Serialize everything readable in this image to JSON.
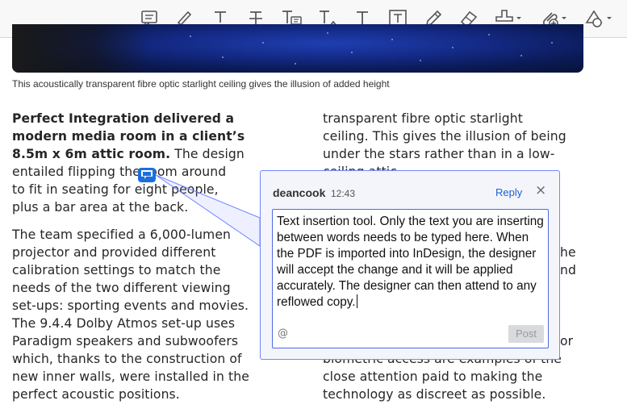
{
  "toolbar": {
    "tools": [
      {
        "name": "comment-tool",
        "icon": "comment-icon"
      },
      {
        "name": "highlight-tool",
        "icon": "highlighter-icon"
      },
      {
        "name": "underline-tool",
        "icon": "underline-text-icon"
      },
      {
        "name": "strikethrough-tool",
        "icon": "strikethrough-text-icon"
      },
      {
        "name": "replace-text-tool",
        "icon": "replace-text-icon"
      },
      {
        "name": "insert-text-tool",
        "icon": "insert-text-icon"
      },
      {
        "name": "add-text-tool",
        "icon": "text-icon"
      },
      {
        "name": "text-box-tool",
        "icon": "text-box-icon"
      },
      {
        "name": "draw-tool",
        "icon": "pencil-icon"
      },
      {
        "name": "eraser-tool",
        "icon": "eraser-icon"
      },
      {
        "name": "stamp-tool",
        "icon": "stamp-icon"
      },
      {
        "name": "attach-file-tool",
        "icon": "attachment-icon"
      },
      {
        "name": "shapes-tool",
        "icon": "shapes-icon"
      }
    ]
  },
  "caption": "This acoustically transparent fibre optic starlight ceiling gives the illusion of added height",
  "article": {
    "col1": {
      "p1_bold": [
        "Perfect Integration delivered a",
        "modern media room in a client’s",
        "8.5m x 6m attic room."
      ],
      "p1_rest_inline": " The design",
      "p1_lines": [
        "entailed flipping the room around",
        "to fit in seating for eight people,",
        "plus a bar area at the back."
      ],
      "p2_lines": [
        "The team specified a 6,000-lumen",
        "projector and provided different",
        "calibration settings to match the",
        "needs of the two different viewing",
        "set-ups: sporting events and movies.",
        "The 9.4.4 Dolby Atmos set-up uses",
        "Paradigm speakers and subwoofers",
        "which, thanks to the construction of",
        "new inner walls, were installed in the",
        "perfect acoustic positions."
      ]
    },
    "col2": {
      "top_lines": [
        "transparent fibre optic starlight",
        "ceiling. This gives the illusion of being",
        "under the stars rather than in a low-",
        "ceiling attic."
      ],
      "side_fragments": [
        "he",
        "nd"
      ],
      "bottom_lines": [
        "biometric access are examples of the",
        "close attention paid to making the",
        "technology as discreet as possible."
      ],
      "bottom_partial": "or"
    }
  },
  "comment": {
    "author": "deancook",
    "time": "12:43",
    "reply_label": "Reply",
    "close_label": "×",
    "body": "Text insertion tool. Only the text you are inserting between words needs to be typed here. When the PDF is imported into InDesign, the designer will accept the change and it will be applied accurately. The designer can then attend to any reflowed copy.",
    "mention_label": "@",
    "post_label": "Post"
  },
  "colors": {
    "accent": "#1a62d6",
    "popup_border": "#7287ff",
    "popup_bg": "#f4f5fa"
  }
}
